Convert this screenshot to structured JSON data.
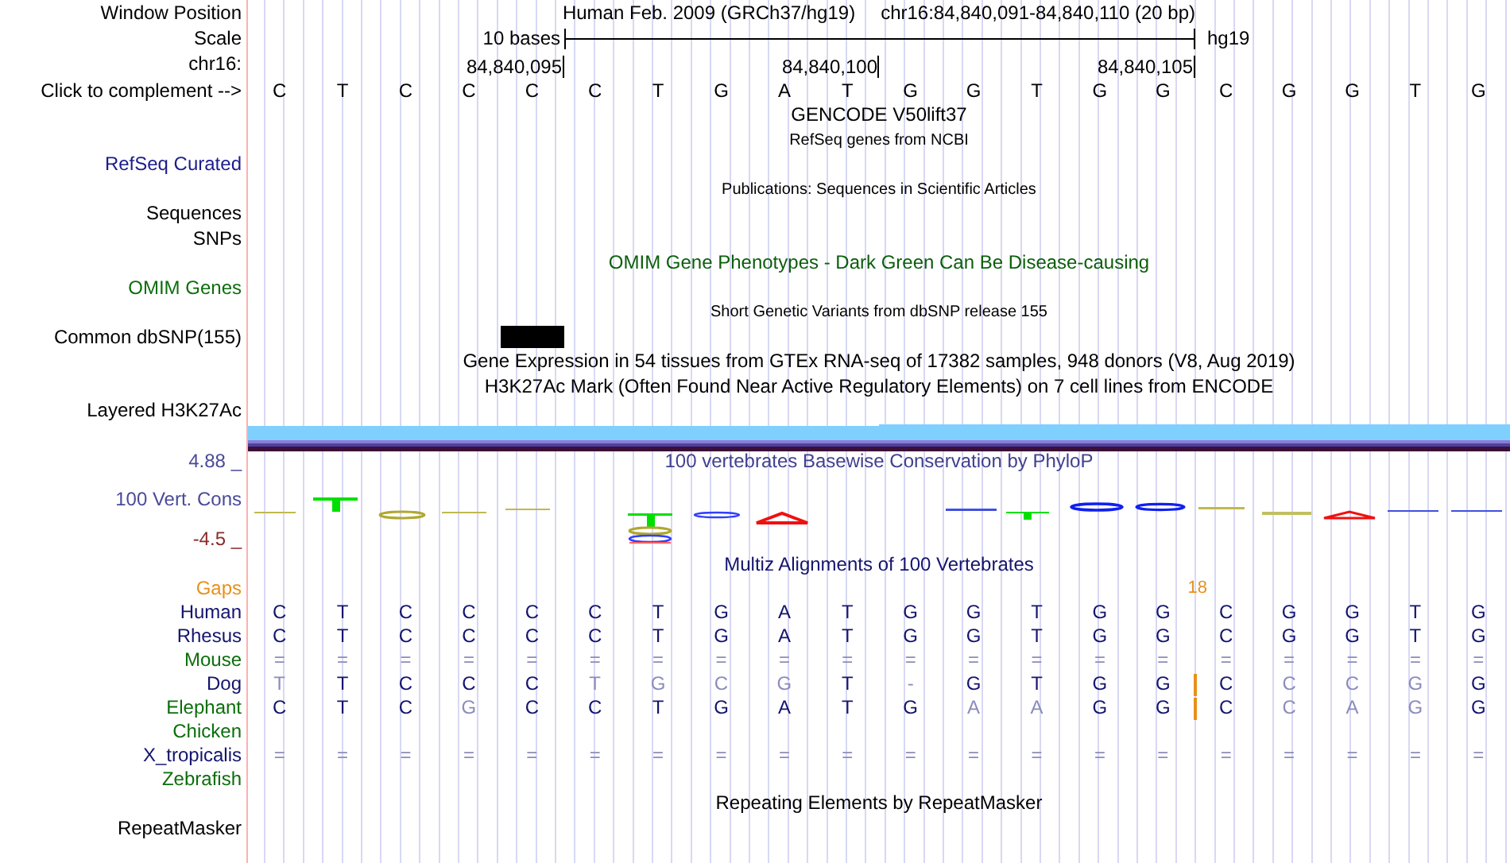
{
  "header": {
    "label": "Window Position",
    "title": "Human Feb. 2009 (GRCh37/hg19)",
    "position": "chr16:84,840,091-84,840,110 (20 bp)"
  },
  "scale": {
    "label": "Scale",
    "bar_label": "10 bases",
    "assembly": "hg19"
  },
  "ruler": {
    "label": "chr16:",
    "ticks": [
      "84,840,095",
      "84,840,100",
      "84,840,105"
    ]
  },
  "sequence": {
    "label": "Click to complement -->",
    "bases": [
      {
        "base": "C",
        "variant": false,
        "insertion_after": false
      },
      {
        "base": "T",
        "variant": false,
        "insertion_after": false
      },
      {
        "base": "C",
        "variant": false,
        "insertion_after": false
      },
      {
        "base": "C",
        "variant": false,
        "insertion_after": false
      },
      {
        "base": "C",
        "variant": true,
        "insertion_after": false
      },
      {
        "base": "C",
        "variant": false,
        "insertion_after": false
      },
      {
        "base": "T",
        "variant": false,
        "insertion_after": false
      },
      {
        "base": "G",
        "variant": false,
        "insertion_after": false
      },
      {
        "base": "A",
        "variant": false,
        "insertion_after": false
      },
      {
        "base": "T",
        "variant": false,
        "insertion_after": false
      },
      {
        "base": "G",
        "variant": false,
        "insertion_after": false
      },
      {
        "base": "G",
        "variant": false,
        "insertion_after": false
      },
      {
        "base": "T",
        "variant": false,
        "insertion_after": false
      },
      {
        "base": "G",
        "variant": false,
        "insertion_after": false
      },
      {
        "base": "G",
        "variant": false,
        "insertion_after": true
      },
      {
        "base": "C",
        "variant": false,
        "insertion_after": false
      },
      {
        "base": "G",
        "variant": false,
        "insertion_after": false
      },
      {
        "base": "G",
        "variant": false,
        "insertion_after": false
      },
      {
        "base": "T",
        "variant": false,
        "insertion_after": false
      },
      {
        "base": "G",
        "variant": false,
        "insertion_after": false
      }
    ]
  },
  "tracks": [
    {
      "kind": "title",
      "text": "GENCODE V50lift37",
      "color": "#000000"
    },
    {
      "kind": "subtitle",
      "text": "RefSeq genes from NCBI"
    },
    {
      "kind": "label",
      "label": "RefSeq Curated",
      "color": "#1c1c8c"
    },
    {
      "kind": "subtitle",
      "text": "Publications: Sequences in Scientific Articles"
    },
    {
      "kind": "label",
      "label": "Sequences",
      "color": "#000000"
    },
    {
      "kind": "label",
      "label": "SNPs",
      "color": "#000000"
    },
    {
      "kind": "title",
      "text": "OMIM Gene Phenotypes - Dark Green Can Be Disease-causing",
      "color": "#0b5e0b"
    },
    {
      "kind": "label",
      "label": "OMIM Genes",
      "color": "#0b6e0b"
    },
    {
      "kind": "subtitle",
      "text": "Short Genetic Variants from dbSNP release 155"
    },
    {
      "kind": "variants",
      "label": "Common dbSNP(155)",
      "color": "#000000"
    },
    {
      "kind": "title",
      "text": "Gene Expression in 54 tissues from GTEx RNA-seq of 17382 samples, 948 donors (V8, Aug 2019)",
      "color": "#000000"
    },
    {
      "kind": "title",
      "text": "H3K27Ac Mark (Often Found Near Active Regulatory Elements) on 7 cell lines from ENCODE",
      "color": "#000000"
    },
    {
      "kind": "label",
      "label": "Layered H3K27Ac",
      "color": "#000000"
    },
    {
      "kind": "signal"
    },
    {
      "kind": "conservation",
      "title": "100 vertebrates Basewise Conservation by PhyloP",
      "label": "100 Vert. Cons",
      "max_label": "4.88 _",
      "min_label": "-4.5 _"
    },
    {
      "kind": "title",
      "text": "Multiz Alignments of 100 Vertebrates",
      "color": "#14146e"
    },
    {
      "kind": "alignment",
      "gaps": {
        "label": "Gaps",
        "color": "#e8901c",
        "count": "18"
      },
      "species": [
        {
          "name": "Human",
          "color": "#14146e",
          "insertion": false,
          "bases": [
            "C",
            "T",
            "C",
            "C",
            "C",
            "C",
            "T",
            "G",
            "A",
            "T",
            "G",
            "G",
            "T",
            "G",
            "G",
            "C",
            "G",
            "G",
            "T",
            "G"
          ]
        },
        {
          "name": "Rhesus",
          "color": "#14146e",
          "insertion": false,
          "bases": [
            "C",
            "T",
            "C",
            "C",
            "C",
            "C",
            "T",
            "G",
            "A",
            "T",
            "G",
            "G",
            "T",
            "G",
            "G",
            "C",
            "G",
            "G",
            "T",
            "G"
          ]
        },
        {
          "name": "Mouse",
          "color": "#0b6e0b",
          "insertion": false,
          "bases": [
            "=",
            "=",
            "=",
            "=",
            "=",
            "=",
            "=",
            "=",
            "=",
            "=",
            "=",
            "=",
            "=",
            "=",
            "=",
            "=",
            "=",
            "=",
            "=",
            "="
          ]
        },
        {
          "name": "Dog",
          "color": "#14146e",
          "insertion": true,
          "bases": [
            "T",
            "T",
            "C",
            "C",
            "C",
            "T",
            "G",
            "C",
            "G",
            "T",
            "-",
            "G",
            "T",
            "G",
            "G",
            "C",
            "C",
            "C",
            "G",
            "G"
          ]
        },
        {
          "name": "Elephant",
          "color": "#0b6e0b",
          "insertion": true,
          "bases": [
            "C",
            "T",
            "C",
            "G",
            "C",
            "C",
            "T",
            "G",
            "A",
            "T",
            "G",
            "A",
            "A",
            "G",
            "G",
            "C",
            "C",
            "A",
            "G",
            "G"
          ]
        },
        {
          "name": "Chicken",
          "color": "#0b6e0b"
        },
        {
          "name": "X_tropicalis",
          "color": "#14146e",
          "insertion": false,
          "bases": [
            "=",
            "=",
            "=",
            "=",
            "=",
            "=",
            "=",
            "=",
            "=",
            "=",
            "=",
            "=",
            "=",
            "=",
            "=",
            "=",
            "=",
            "=",
            "=",
            "="
          ]
        },
        {
          "name": "Zebrafish",
          "color": "#0b6e0b"
        }
      ]
    },
    {
      "kind": "title",
      "text": "Repeating Elements by RepeatMasker",
      "color": "#000000"
    },
    {
      "kind": "label",
      "label": "RepeatMasker",
      "color": "#000000"
    }
  ]
}
